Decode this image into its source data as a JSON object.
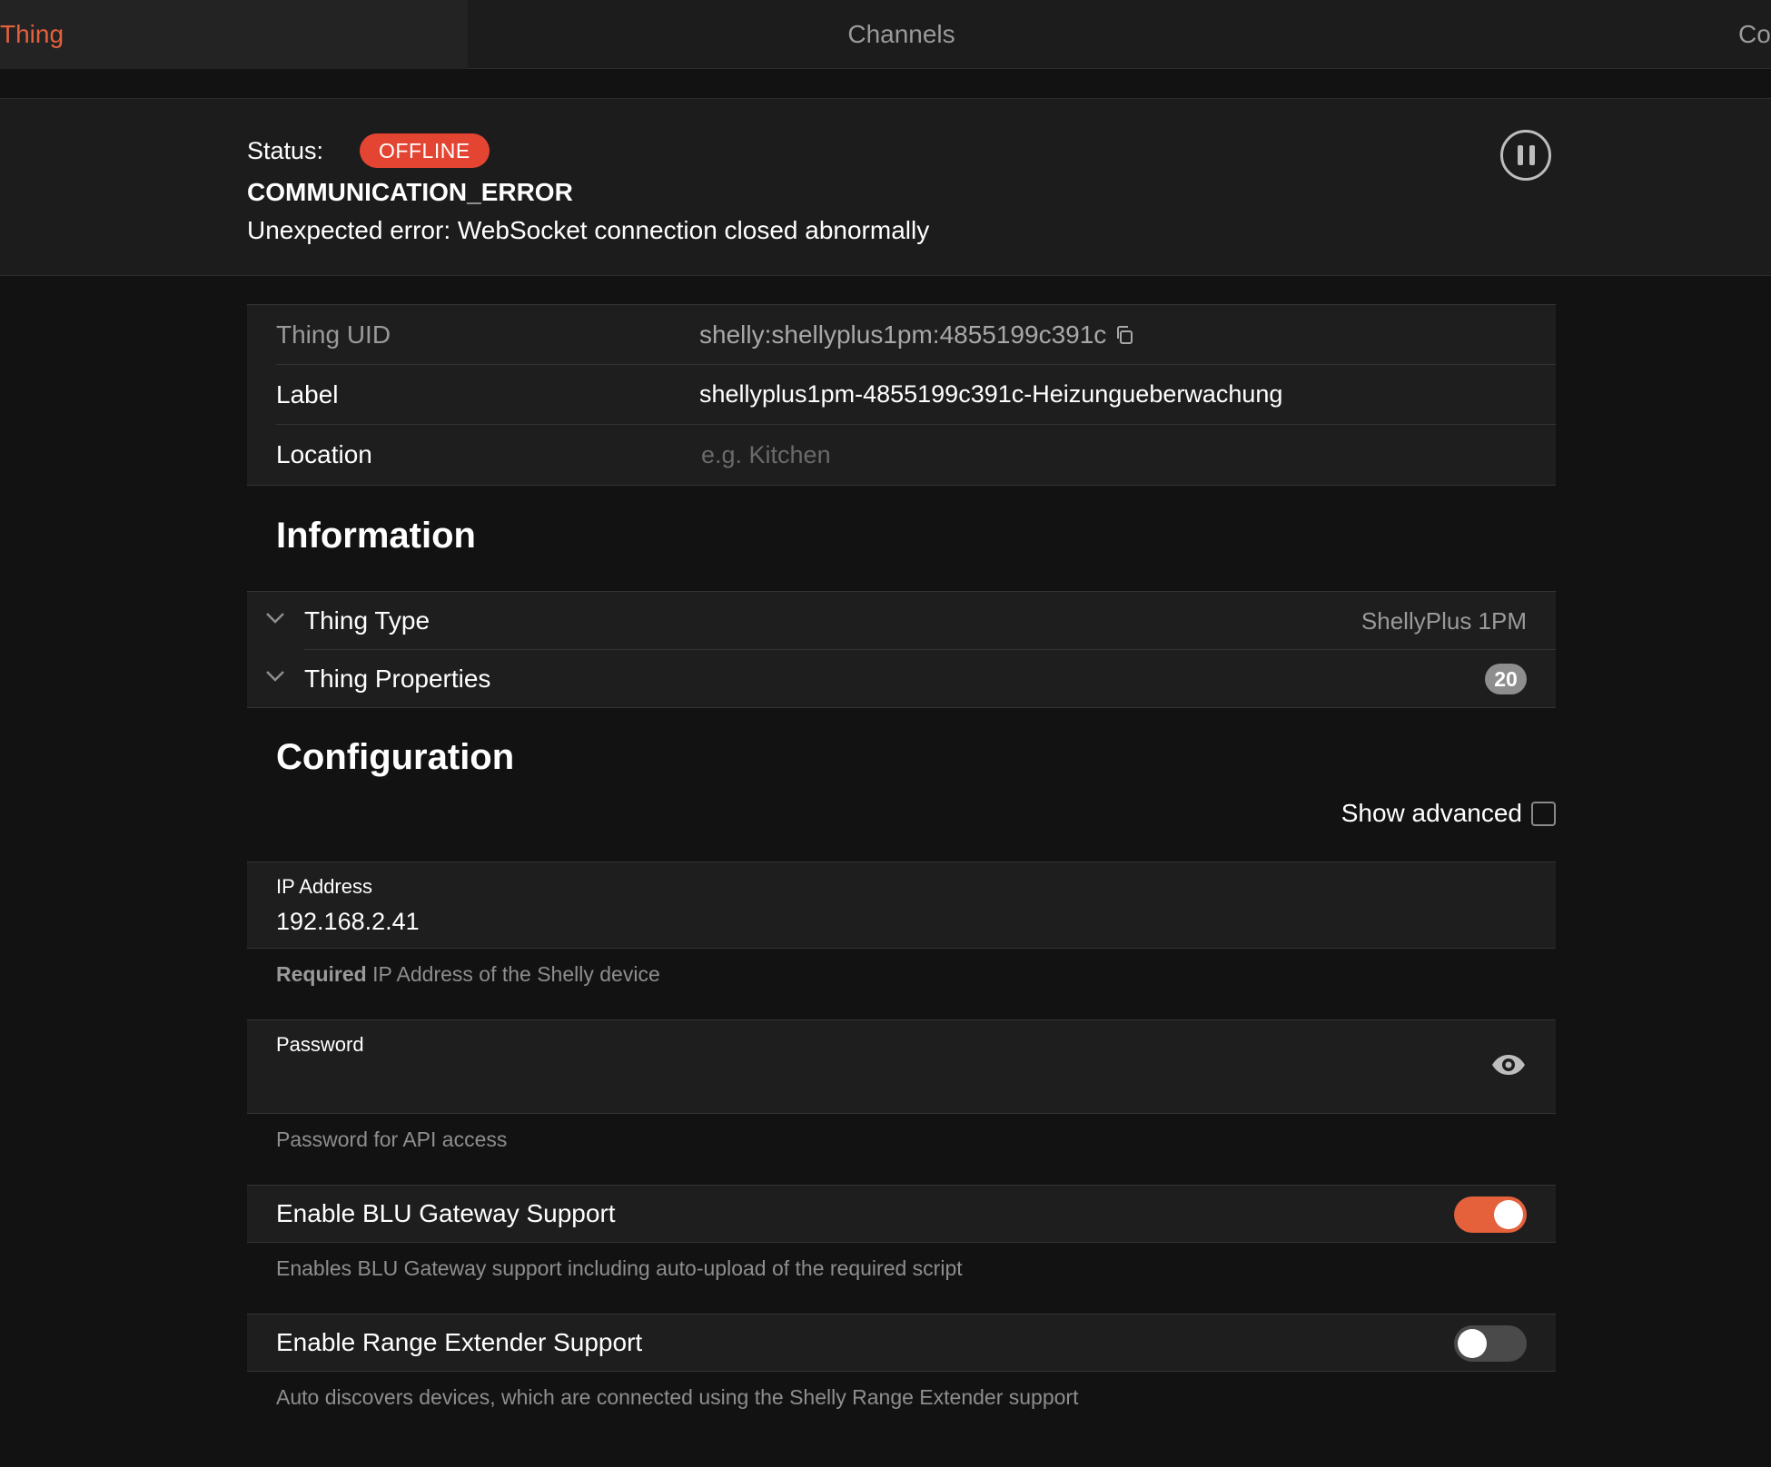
{
  "tabs": [
    {
      "label": "Thing",
      "active": true
    },
    {
      "label": "Channels",
      "active": false
    },
    {
      "label": "Co",
      "active": false
    }
  ],
  "status": {
    "label": "Status:",
    "badge": "OFFLINE",
    "code": "COMMUNICATION_ERROR",
    "description": "Unexpected error: WebSocket connection closed abnormally"
  },
  "details": {
    "uid_label": "Thing UID",
    "uid_value": "shelly:shellyplus1pm:4855199c391c",
    "label_label": "Label",
    "label_value": "shellyplus1pm-4855199c391c-Heizungueberwachung",
    "location_label": "Location",
    "location_placeholder": "e.g. Kitchen"
  },
  "information": {
    "title": "Information",
    "thing_type_label": "Thing Type",
    "thing_type_value": "ShellyPlus 1PM",
    "thing_properties_label": "Thing Properties",
    "thing_properties_count": "20"
  },
  "configuration": {
    "title": "Configuration",
    "show_advanced_label": "Show advanced",
    "show_advanced_checked": false,
    "ip_label": "IP Address",
    "ip_value": "192.168.2.41",
    "ip_hint_required": "Required",
    "ip_hint": "IP Address of the Shelly device",
    "password_label": "Password",
    "password_hint": "Password for API access",
    "blu_label": "Enable BLU Gateway Support",
    "blu_enabled": true,
    "blu_hint": "Enables BLU Gateway support including auto-upload of the required script",
    "range_label": "Enable Range Extender Support",
    "range_enabled": false,
    "range_hint": "Auto discovers devices, which are connected using the Shelly Range Extender support"
  },
  "colors": {
    "accent": "#e4613c",
    "offline": "#e44533",
    "background": "#121212",
    "panel": "#1e1e1e"
  },
  "icons": [
    "pause-icon",
    "copy-icon",
    "chevron-down-icon",
    "eye-icon",
    "checkbox"
  ]
}
